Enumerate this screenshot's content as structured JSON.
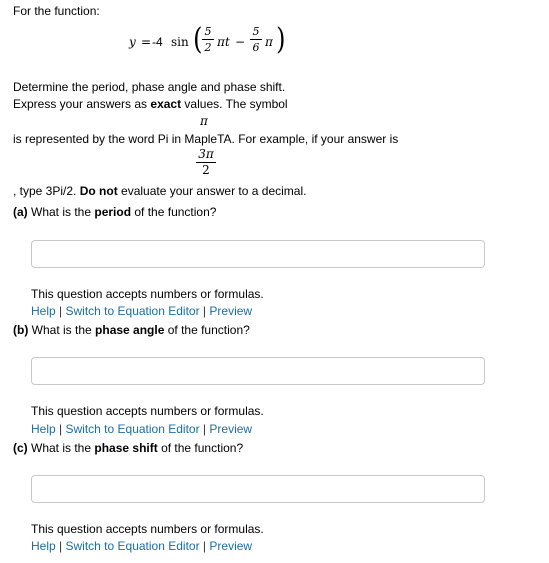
{
  "intro": "For the function:",
  "equation": {
    "lhs": "y",
    "eq": "=",
    "coef": "-4",
    "func": "sin",
    "frac1_num": "5",
    "frac1_den": "2",
    "pi": "π",
    "t": "t",
    "minus": "−",
    "frac2_num": "5",
    "frac2_den": "6"
  },
  "instructions": {
    "line1": "Determine the period, phase angle and phase shift.",
    "line2_pre": "Express your answers as ",
    "line2_bold": "exact",
    "line2_post": " values. The symbol",
    "pi_symbol": "π",
    "line3": "is represented by the word Pi in MapleTA. For example, if your answer is",
    "example_num": "3π",
    "example_den": "2",
    "line4_pre": ", type 3Pi/2. ",
    "line4_bold": "Do not",
    "line4_post": " evaluate your answer to a decimal."
  },
  "questions": [
    {
      "label": "(a)",
      "text_pre": " What is the ",
      "text_bold": "period",
      "text_post": " of the function?",
      "note": "This question accepts numbers or formulas.",
      "value": ""
    },
    {
      "label": "(b)",
      "text_pre": " What is the ",
      "text_bold": "phase angle",
      "text_post": " of the function?",
      "note": "This question accepts numbers or formulas.",
      "value": ""
    },
    {
      "label": "(c)",
      "text_pre": " What is the ",
      "text_bold": "phase shift",
      "text_post": " of the function?",
      "note": "This question accepts numbers or formulas.",
      "value": ""
    }
  ],
  "links": {
    "help": "Help",
    "separator": "|",
    "switch_editor": "Switch to Equation Editor",
    "preview": "Preview"
  },
  "colors": {
    "link": "#1a6fa3",
    "input_border": "#c9c9c9"
  }
}
